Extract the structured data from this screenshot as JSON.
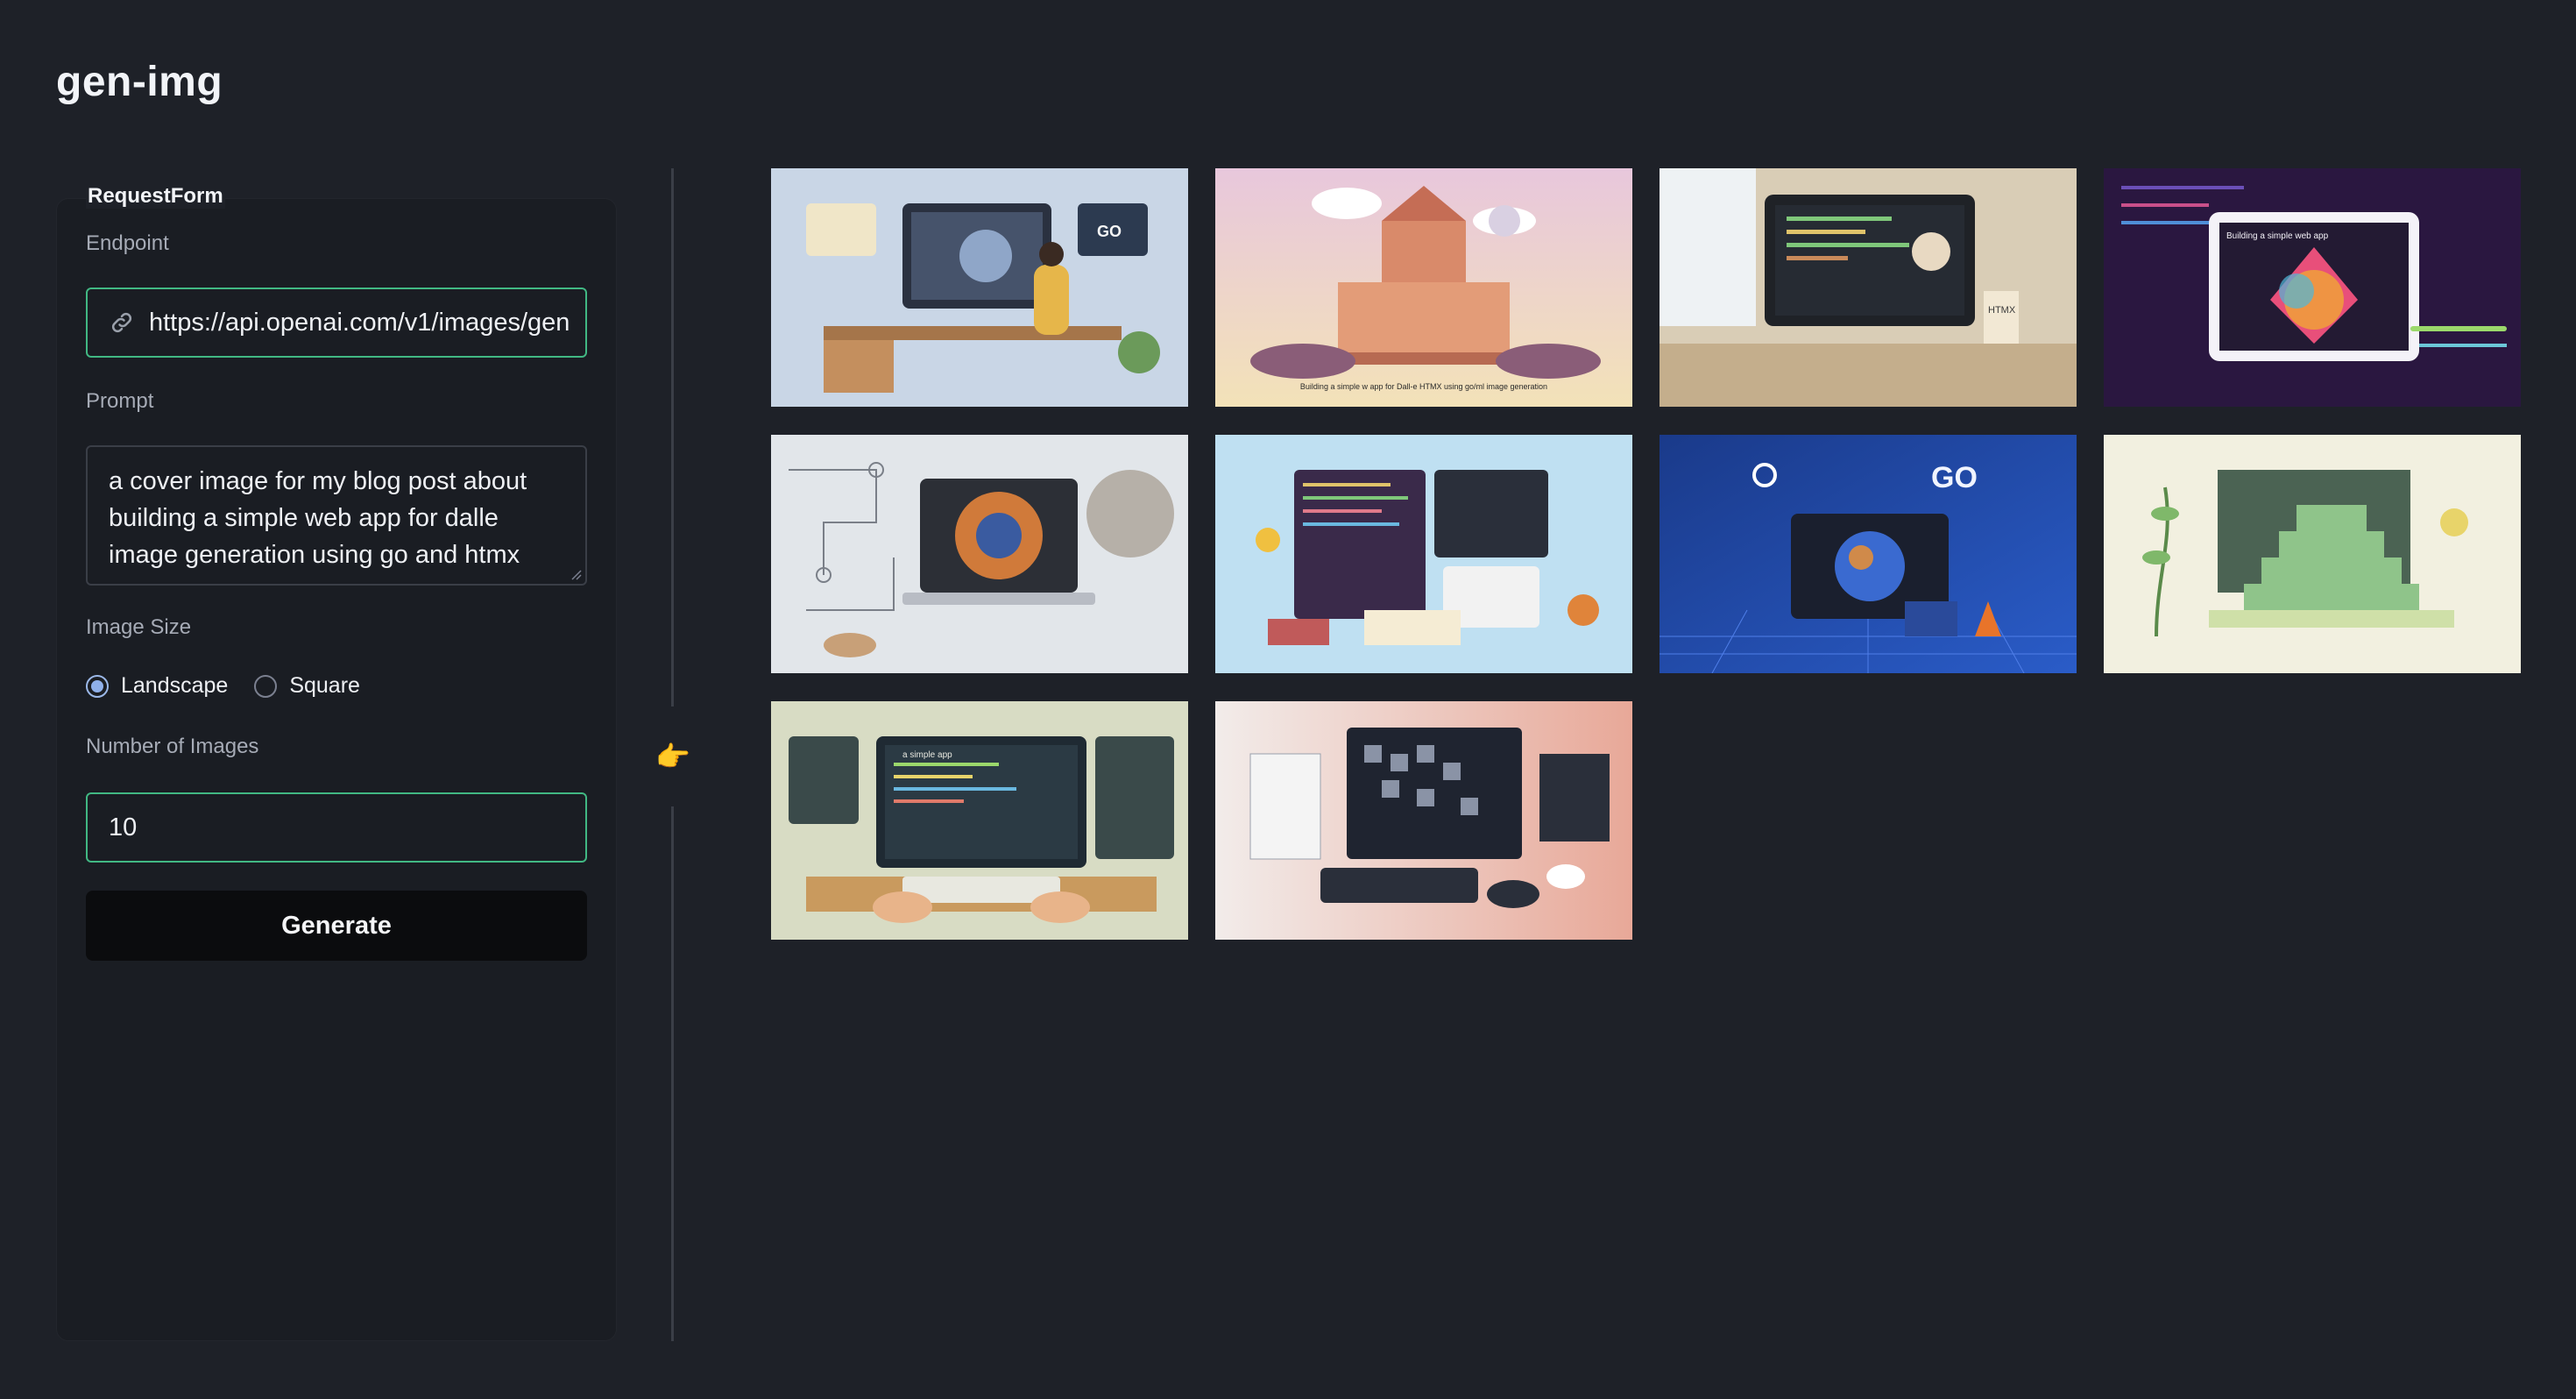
{
  "app": {
    "title": "gen-img"
  },
  "form": {
    "legend": "RequestForm",
    "endpoint_label": "Endpoint",
    "endpoint_value": "https://api.openai.com/v1/images/gen",
    "prompt_label": "Prompt",
    "prompt_value": "a cover image for my blog post about building a simple web app for dalle image generation using go and htmx",
    "size_label": "Image Size",
    "size_options": [
      {
        "label": "Landscape",
        "selected": true
      },
      {
        "label": "Square",
        "selected": false
      }
    ],
    "count_label": "Number of Images",
    "count_value": "10",
    "generate_label": "Generate"
  },
  "divider": {
    "handle_icon": "pointing-hand-icon"
  },
  "gallery": {
    "images": [
      {
        "name": "generated-image-1",
        "caption": "GO"
      },
      {
        "name": "generated-image-2",
        "caption": "Building a simple w app for Dall-e HTMX using go/ml image generation"
      },
      {
        "name": "generated-image-3",
        "caption": "HTMX"
      },
      {
        "name": "generated-image-4",
        "caption": "Building a simple web app"
      },
      {
        "name": "generated-image-5",
        "caption": ""
      },
      {
        "name": "generated-image-6",
        "caption": ""
      },
      {
        "name": "generated-image-7",
        "caption": "GO"
      },
      {
        "name": "generated-image-8",
        "caption": ""
      },
      {
        "name": "generated-image-9",
        "caption": "a simple app"
      },
      {
        "name": "generated-image-10",
        "caption": ""
      }
    ]
  }
}
